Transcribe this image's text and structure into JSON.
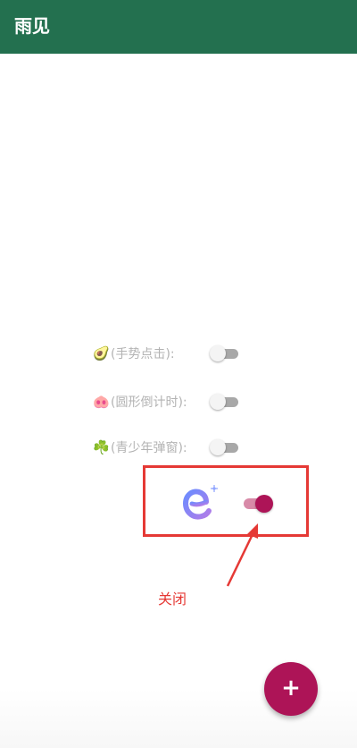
{
  "app_bar": {
    "title": "雨见",
    "color": "#23704f"
  },
  "settings": [
    {
      "icon": "avocado-icon",
      "emoji": "🥑",
      "label": "(手势点击):",
      "enabled": false
    },
    {
      "icon": "pig-icon",
      "emoji": "🐽",
      "label": "(圆形倒计时):",
      "enabled": false
    },
    {
      "icon": "clover-icon",
      "emoji": "☘️",
      "label": "(青少年弹窗):",
      "enabled": false
    }
  ],
  "highlight": {
    "logo_icon": "app-logo-icon",
    "toggle_enabled": true,
    "accent_color": "#ad1457",
    "box_color": "#e53935"
  },
  "annotation": {
    "text": "关闭",
    "color": "#e53935"
  },
  "fab": {
    "label": "+",
    "icon": "plus-icon",
    "color": "#ad1457"
  }
}
